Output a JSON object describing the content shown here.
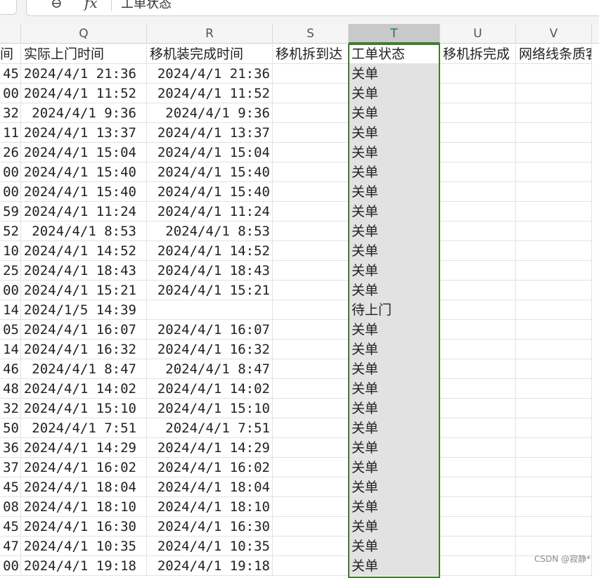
{
  "formula_bar": {
    "fx_label": "fx",
    "content": "工单状态"
  },
  "columns": [
    "Q",
    "R",
    "S",
    "T",
    "U",
    "V"
  ],
  "selected_column": "T",
  "header_row": {
    "p_partial": "间",
    "q": "实际上门时间",
    "r": "移机装完成时间",
    "s": "移机拆到达",
    "t": "工单状态",
    "u": "移机拆完成",
    "v": "网络线条质客"
  },
  "rows": [
    {
      "p": "45",
      "q": "2024/4/1 21:36",
      "r": "2024/4/1 21:36",
      "t": "关单"
    },
    {
      "p": "00",
      "q": "2024/4/1 11:52",
      "r": "2024/4/1 11:52",
      "t": "关单"
    },
    {
      "p": "32",
      "q": "2024/4/1 9:36",
      "r": "2024/4/1 9:36",
      "t": "关单"
    },
    {
      "p": "11",
      "q": "2024/4/1 13:37",
      "r": "2024/4/1 13:37",
      "t": "关单"
    },
    {
      "p": "26",
      "q": "2024/4/1 15:04",
      "r": "2024/4/1 15:04",
      "t": "关单"
    },
    {
      "p": "00",
      "q": "2024/4/1 15:40",
      "r": "2024/4/1 15:40",
      "t": "关单"
    },
    {
      "p": "00",
      "q": "2024/4/1 15:40",
      "r": "2024/4/1 15:40",
      "t": "关单"
    },
    {
      "p": "59",
      "q": "2024/4/1 11:24",
      "r": "2024/4/1 11:24",
      "t": "关单"
    },
    {
      "p": "52",
      "q": "2024/4/1 8:53",
      "r": "2024/4/1 8:53",
      "t": "关单"
    },
    {
      "p": "10",
      "q": "2024/4/1 14:52",
      "r": "2024/4/1 14:52",
      "t": "关单"
    },
    {
      "p": "25",
      "q": "2024/4/1 18:43",
      "r": "2024/4/1 18:43",
      "t": "关单"
    },
    {
      "p": "00",
      "q": "2024/4/1 15:21",
      "r": "2024/4/1 15:21",
      "t": "关单"
    },
    {
      "p": "14",
      "q": "2024/1/5 14:39",
      "r": "",
      "t": "待上门"
    },
    {
      "p": "05",
      "q": "2024/4/1 16:07",
      "r": "2024/4/1 16:07",
      "t": "关单"
    },
    {
      "p": "14",
      "q": "2024/4/1 16:32",
      "r": "2024/4/1 16:32",
      "t": "关单"
    },
    {
      "p": "46",
      "q": "2024/4/1 8:47",
      "r": "2024/4/1 8:47",
      "t": "关单"
    },
    {
      "p": "48",
      "q": "2024/4/1 14:02",
      "r": "2024/4/1 14:02",
      "t": "关单"
    },
    {
      "p": "32",
      "q": "2024/4/1 15:10",
      "r": "2024/4/1 15:10",
      "t": "关单"
    },
    {
      "p": "50",
      "q": "2024/4/1 7:51",
      "r": "2024/4/1 7:51",
      "t": "关单"
    },
    {
      "p": "36",
      "q": "2024/4/1 14:29",
      "r": "2024/4/1 14:29",
      "t": "关单"
    },
    {
      "p": "37",
      "q": "2024/4/1 16:02",
      "r": "2024/4/1 16:02",
      "t": "关单"
    },
    {
      "p": "45",
      "q": "2024/4/1 18:04",
      "r": "2024/4/1 18:04",
      "t": "关单"
    },
    {
      "p": "08",
      "q": "2024/4/1 18:10",
      "r": "2024/4/1 18:10",
      "t": "关单"
    },
    {
      "p": "45",
      "q": "2024/4/1 16:30",
      "r": "2024/4/1 16:30",
      "t": "关单"
    },
    {
      "p": "47",
      "q": "2024/4/1 10:35",
      "r": "2024/4/1 10:35",
      "t": "关单"
    },
    {
      "p": "00",
      "q": "2024/4/1 19:18",
      "r": "2024/4/1 19:18",
      "t": "关单"
    }
  ],
  "watermark": "CSDN @寂静*",
  "colors": {
    "selection_border": "#3e7d2f",
    "selected_header_bg": "#c9c9c9",
    "selected_cell_bg": "#e2e2e2"
  }
}
